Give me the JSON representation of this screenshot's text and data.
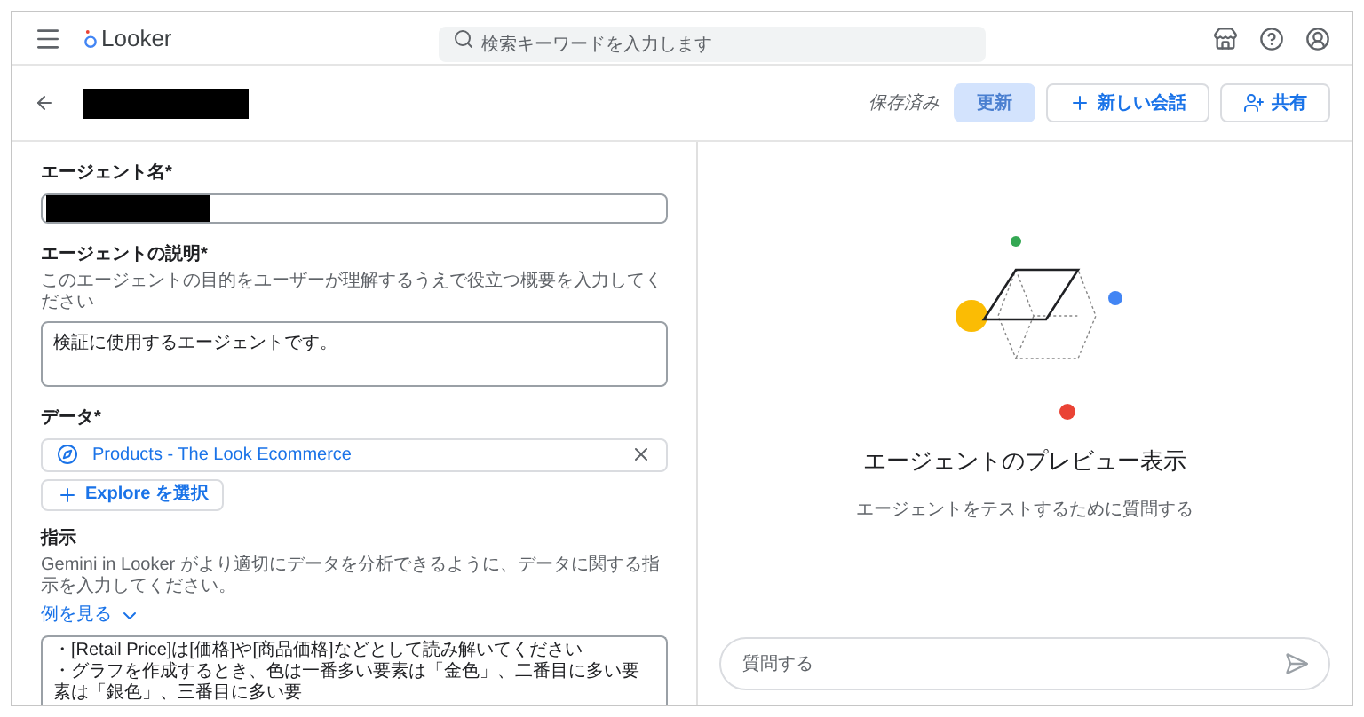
{
  "header": {
    "logo_text": "Looker",
    "search": {
      "placeholder": "検索キーワードを入力します"
    }
  },
  "toolbar": {
    "status": "保存済み",
    "buttons": [
      {
        "kind": "update",
        "label": "更新",
        "disabled": true
      },
      {
        "kind": "new_chat",
        "label": "新しい会話",
        "disabled": false
      },
      {
        "kind": "share",
        "label": "共有",
        "disabled": false
      }
    ]
  },
  "form": {
    "name": {
      "label": "エージェント名*"
    },
    "description": {
      "label": "エージェントの説明*",
      "hint": "このエージェントの目的をユーザーが理解するうえで役立つ概要を入力してください",
      "value": "検証に使用するエージェントです。"
    },
    "data": {
      "label": "データ*",
      "selected_explore": "Products - The Look Ecommerce",
      "add_button": "Explore を選択"
    },
    "instructions": {
      "label": "指示",
      "hint": "Gemini in Looker がより適切にデータを分析できるように、データに関する指示を入力してください。",
      "examples_link": "例を見る",
      "lines": [
        "・[Retail Price]は[価格]や[商品価格]などとして読み解いてください",
        "・グラフを作成するとき、色は一番多い要素は「金色」、二番目に多い要素は「銀色」、三番目に多い要"
      ]
    }
  },
  "preview": {
    "title": "エージェントのプレビュー表示",
    "subtitle": "エージェントをテストするために質問する",
    "input": {
      "placeholder": "質問する"
    }
  }
}
